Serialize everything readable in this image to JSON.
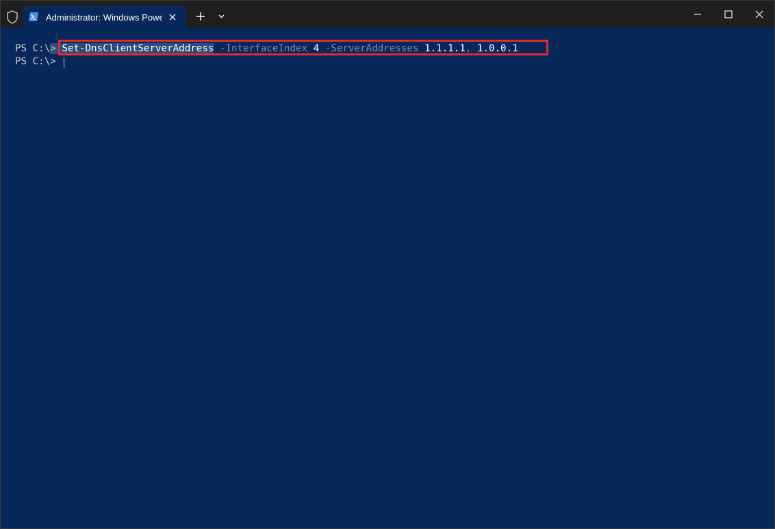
{
  "titlebar": {
    "tab_title": "Administrator: Windows PowerShell",
    "icons": {
      "shield": "shield-icon",
      "tab": "powershell-icon",
      "tab_close": "close-icon",
      "new_tab": "plus-icon",
      "dropdown": "chevron-down-icon",
      "minimize": "minimize-icon",
      "maximize": "maximize-icon",
      "close": "close-icon"
    }
  },
  "terminal": {
    "line1": {
      "prompt": "PS C:\\",
      "caret": ">",
      "gap": " ",
      "cmdlet": "Set-DnsClientServerAddress",
      "param1": " -InterfaceIndex",
      "value1": " 4",
      "param2": " -ServerAddresses",
      "address1": " 1.1.1.1",
      "comma": ",",
      "address2": " 1.0.0.1"
    },
    "line2": {
      "prompt": "PS C:\\> "
    }
  },
  "colors": {
    "background": "#07285a",
    "titlebar": "#1f1f1f",
    "highlight_border": "#e8282b",
    "selection": "#2b4c7d"
  }
}
